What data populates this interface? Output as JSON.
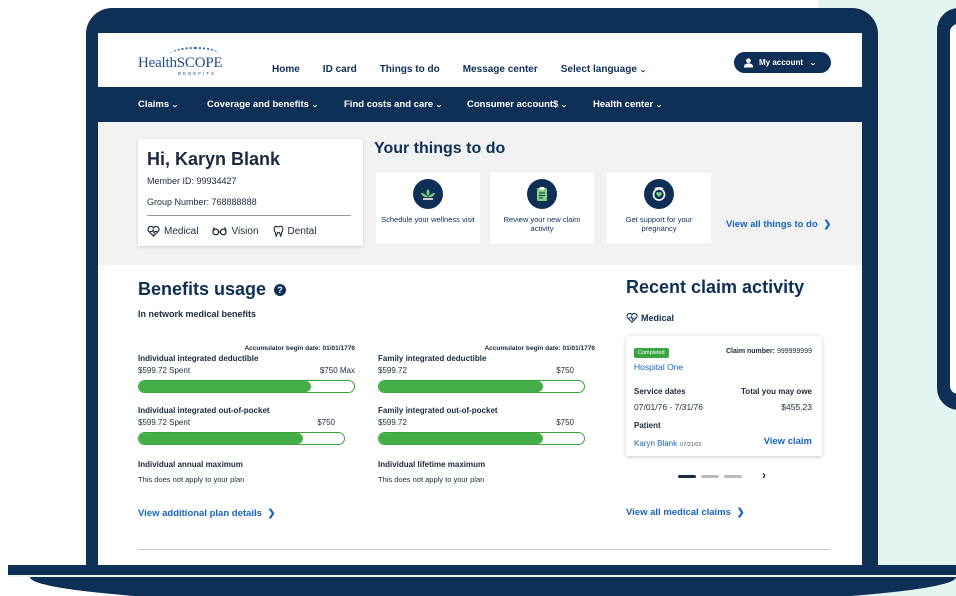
{
  "brand": {
    "name": "HealthSCOPE",
    "tagline": "BENEFITS"
  },
  "top_nav": {
    "links": [
      "Home",
      "ID card",
      "Things to do",
      "Message center",
      "Select language"
    ],
    "account_label": "My account"
  },
  "main_nav": [
    "Claims",
    "Coverage and benefits",
    "Find costs and care",
    "Consumer account$",
    "Health center"
  ],
  "member": {
    "greeting": "Hi, Karyn Blank",
    "member_id": "Member ID: 99934427",
    "group_number": "Group Number: 768888888",
    "coverages": [
      "Medical",
      "Vision",
      "Dental"
    ]
  },
  "things_to_do": {
    "title": "Your things to do",
    "items": [
      {
        "label": "Schedule your wellness visit",
        "icon": "lotus-icon"
      },
      {
        "label": "Review your new claim activity",
        "icon": "clipboard-icon"
      },
      {
        "label": "Get support for your pregnancy",
        "icon": "pregnancy-icon"
      }
    ],
    "view_all": "View all things to do"
  },
  "benefits_usage": {
    "title": "Benefits usage",
    "subtitle": "In network medical benefits",
    "individual": {
      "accumulator": "Accumulator begin date: 01/01/1776",
      "deductible": {
        "name": "Individual integrated deductible",
        "left": "$599.72 Spent",
        "right": "$750 Max",
        "fraction": 0.8
      },
      "oop": {
        "name": "Individual integrated out-of-pocket",
        "left": "$599.72 Spent",
        "right": "$750",
        "fraction": 0.8
      },
      "max": {
        "name": "Individual annual maximum",
        "note": "This does not apply to your plan"
      }
    },
    "family": {
      "accumulator": "Accumulator begin date: 01/01/1776",
      "deductible": {
        "name": "Family integrated deductible",
        "left": "$599.72",
        "right": "$750",
        "fraction": 0.8
      },
      "oop": {
        "name": "Family integrated out-of-pocket",
        "left": "$599.72",
        "right": "$750",
        "fraction": 0.8
      },
      "max": {
        "name": "Individual lifetime maximum",
        "note": "This does not apply to your plan"
      }
    },
    "view_plan": "View additional plan details"
  },
  "claims": {
    "title": "Recent claim activity",
    "category": "Medical",
    "card": {
      "status": "Completed",
      "claim_number_label": "Claim number:",
      "claim_number": "999999999",
      "provider": "Hospital One",
      "service_dates_label": "Service dates",
      "service_dates": "07/01/76 - 7/31/76",
      "owe_label": "Total you may owe",
      "owe": "$455.23",
      "patient_label": "Patient",
      "patient_name": "Karyn Blank",
      "patient_dob": "07/21/02",
      "view_claim": "View claim"
    },
    "carousel": {
      "count": 3,
      "active": 0
    },
    "view_all": "View all medical claims"
  },
  "colors": {
    "navy": "#0e2f56",
    "link": "#1565c0",
    "green": "#45ad48",
    "teal_bg": "#e4f4f1"
  }
}
